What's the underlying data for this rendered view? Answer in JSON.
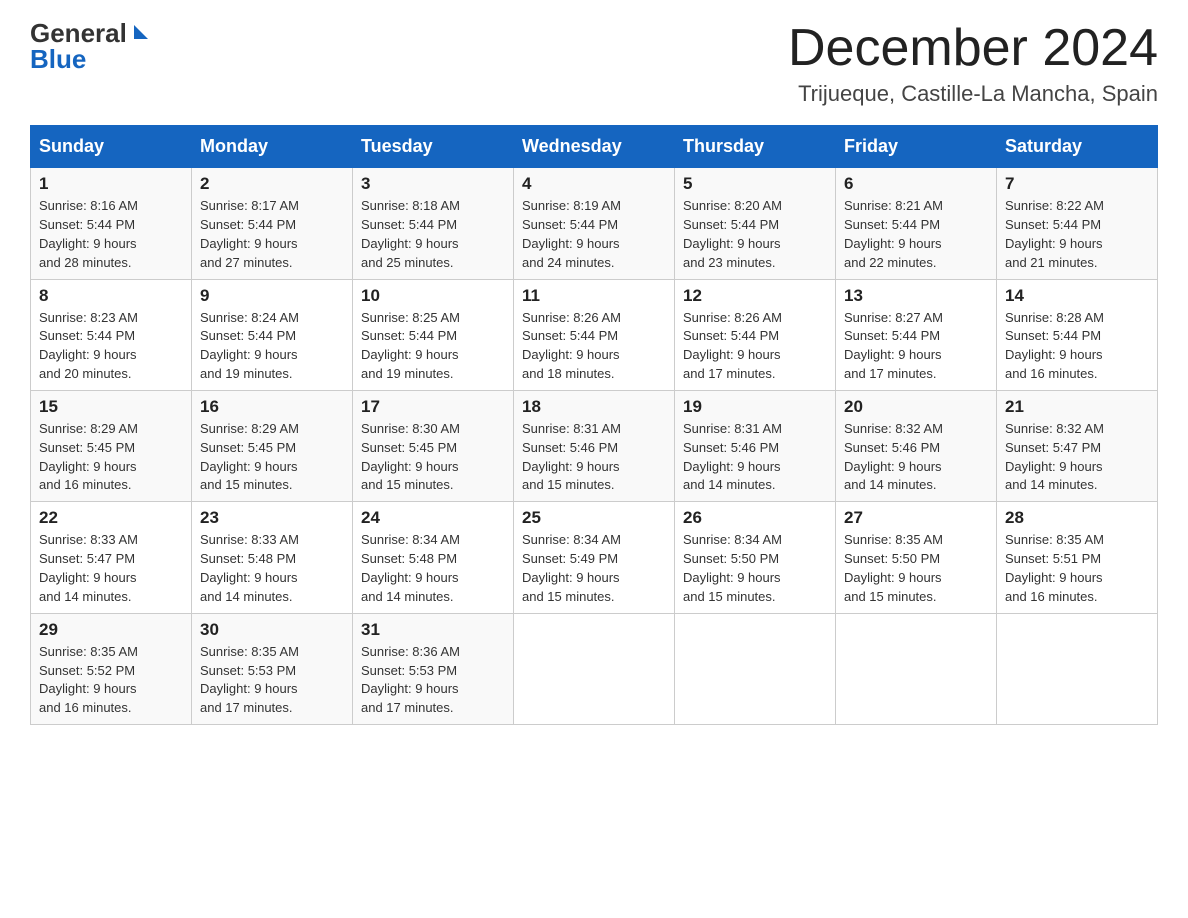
{
  "header": {
    "logo_general": "General",
    "logo_blue": "Blue",
    "month_title": "December 2024",
    "location": "Trijueque, Castille-La Mancha, Spain"
  },
  "days_of_week": [
    "Sunday",
    "Monday",
    "Tuesday",
    "Wednesday",
    "Thursday",
    "Friday",
    "Saturday"
  ],
  "weeks": [
    [
      {
        "day": "1",
        "sunrise": "8:16 AM",
        "sunset": "5:44 PM",
        "daylight": "9 hours and 28 minutes."
      },
      {
        "day": "2",
        "sunrise": "8:17 AM",
        "sunset": "5:44 PM",
        "daylight": "9 hours and 27 minutes."
      },
      {
        "day": "3",
        "sunrise": "8:18 AM",
        "sunset": "5:44 PM",
        "daylight": "9 hours and 25 minutes."
      },
      {
        "day": "4",
        "sunrise": "8:19 AM",
        "sunset": "5:44 PM",
        "daylight": "9 hours and 24 minutes."
      },
      {
        "day": "5",
        "sunrise": "8:20 AM",
        "sunset": "5:44 PM",
        "daylight": "9 hours and 23 minutes."
      },
      {
        "day": "6",
        "sunrise": "8:21 AM",
        "sunset": "5:44 PM",
        "daylight": "9 hours and 22 minutes."
      },
      {
        "day": "7",
        "sunrise": "8:22 AM",
        "sunset": "5:44 PM",
        "daylight": "9 hours and 21 minutes."
      }
    ],
    [
      {
        "day": "8",
        "sunrise": "8:23 AM",
        "sunset": "5:44 PM",
        "daylight": "9 hours and 20 minutes."
      },
      {
        "day": "9",
        "sunrise": "8:24 AM",
        "sunset": "5:44 PM",
        "daylight": "9 hours and 19 minutes."
      },
      {
        "day": "10",
        "sunrise": "8:25 AM",
        "sunset": "5:44 PM",
        "daylight": "9 hours and 19 minutes."
      },
      {
        "day": "11",
        "sunrise": "8:26 AM",
        "sunset": "5:44 PM",
        "daylight": "9 hours and 18 minutes."
      },
      {
        "day": "12",
        "sunrise": "8:26 AM",
        "sunset": "5:44 PM",
        "daylight": "9 hours and 17 minutes."
      },
      {
        "day": "13",
        "sunrise": "8:27 AM",
        "sunset": "5:44 PM",
        "daylight": "9 hours and 17 minutes."
      },
      {
        "day": "14",
        "sunrise": "8:28 AM",
        "sunset": "5:44 PM",
        "daylight": "9 hours and 16 minutes."
      }
    ],
    [
      {
        "day": "15",
        "sunrise": "8:29 AM",
        "sunset": "5:45 PM",
        "daylight": "9 hours and 16 minutes."
      },
      {
        "day": "16",
        "sunrise": "8:29 AM",
        "sunset": "5:45 PM",
        "daylight": "9 hours and 15 minutes."
      },
      {
        "day": "17",
        "sunrise": "8:30 AM",
        "sunset": "5:45 PM",
        "daylight": "9 hours and 15 minutes."
      },
      {
        "day": "18",
        "sunrise": "8:31 AM",
        "sunset": "5:46 PM",
        "daylight": "9 hours and 15 minutes."
      },
      {
        "day": "19",
        "sunrise": "8:31 AM",
        "sunset": "5:46 PM",
        "daylight": "9 hours and 14 minutes."
      },
      {
        "day": "20",
        "sunrise": "8:32 AM",
        "sunset": "5:46 PM",
        "daylight": "9 hours and 14 minutes."
      },
      {
        "day": "21",
        "sunrise": "8:32 AM",
        "sunset": "5:47 PM",
        "daylight": "9 hours and 14 minutes."
      }
    ],
    [
      {
        "day": "22",
        "sunrise": "8:33 AM",
        "sunset": "5:47 PM",
        "daylight": "9 hours and 14 minutes."
      },
      {
        "day": "23",
        "sunrise": "8:33 AM",
        "sunset": "5:48 PM",
        "daylight": "9 hours and 14 minutes."
      },
      {
        "day": "24",
        "sunrise": "8:34 AM",
        "sunset": "5:48 PM",
        "daylight": "9 hours and 14 minutes."
      },
      {
        "day": "25",
        "sunrise": "8:34 AM",
        "sunset": "5:49 PM",
        "daylight": "9 hours and 15 minutes."
      },
      {
        "day": "26",
        "sunrise": "8:34 AM",
        "sunset": "5:50 PM",
        "daylight": "9 hours and 15 minutes."
      },
      {
        "day": "27",
        "sunrise": "8:35 AM",
        "sunset": "5:50 PM",
        "daylight": "9 hours and 15 minutes."
      },
      {
        "day": "28",
        "sunrise": "8:35 AM",
        "sunset": "5:51 PM",
        "daylight": "9 hours and 16 minutes."
      }
    ],
    [
      {
        "day": "29",
        "sunrise": "8:35 AM",
        "sunset": "5:52 PM",
        "daylight": "9 hours and 16 minutes."
      },
      {
        "day": "30",
        "sunrise": "8:35 AM",
        "sunset": "5:53 PM",
        "daylight": "9 hours and 17 minutes."
      },
      {
        "day": "31",
        "sunrise": "8:36 AM",
        "sunset": "5:53 PM",
        "daylight": "9 hours and 17 minutes."
      },
      null,
      null,
      null,
      null
    ]
  ],
  "labels": {
    "sunrise": "Sunrise:",
    "sunset": "Sunset:",
    "daylight": "Daylight:"
  }
}
